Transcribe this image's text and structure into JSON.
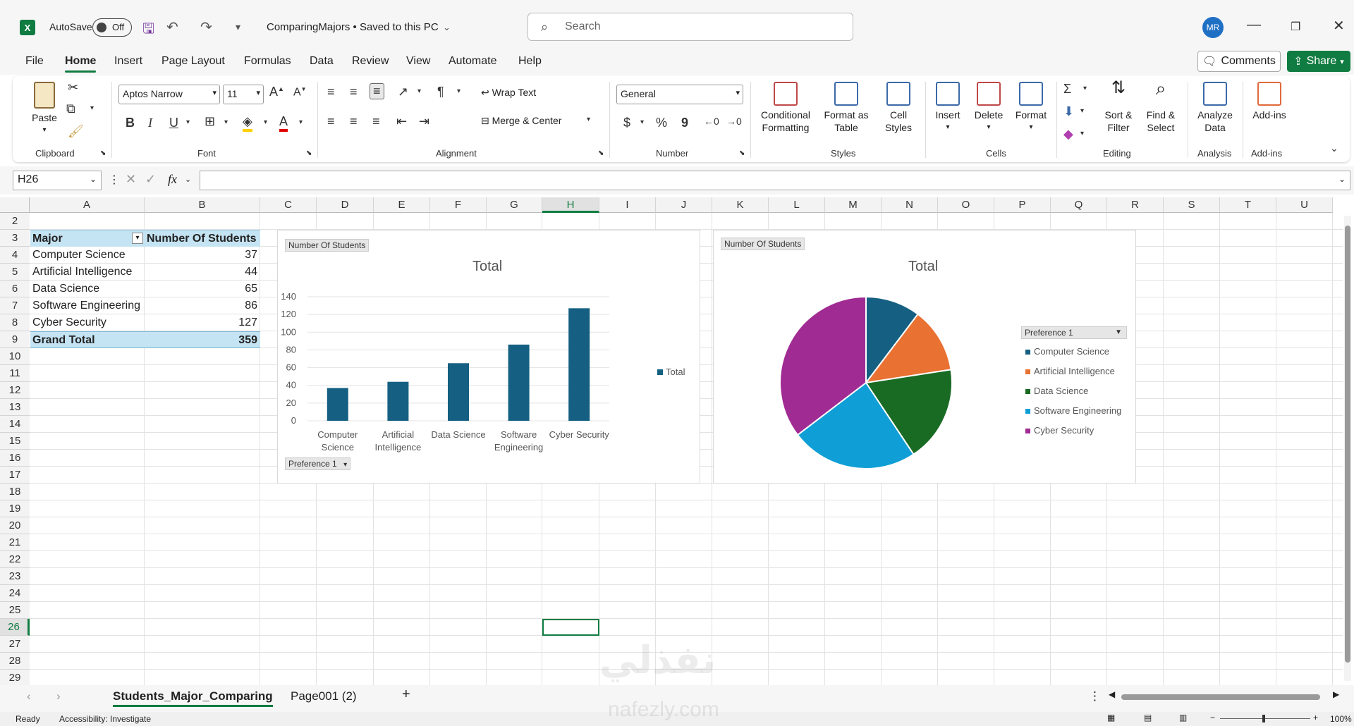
{
  "titlebar": {
    "app_logo": "X",
    "autosave_label": "AutoSave",
    "autosave_state": "Off",
    "doc_title": "ComparingMajors • Saved to this PC",
    "search_placeholder": "Search",
    "avatar_initials": "MR"
  },
  "menu": {
    "items": [
      "File",
      "Home",
      "Insert",
      "Page Layout",
      "Formulas",
      "Data",
      "Review",
      "View",
      "Automate",
      "Help"
    ],
    "active": "Home",
    "comments_label": "Comments",
    "share_label": "Share"
  },
  "ribbon": {
    "clipboard": {
      "paste": "Paste",
      "label": "Clipboard"
    },
    "font": {
      "name": "Aptos Narrow",
      "size": "11",
      "bold": "B",
      "italic": "I",
      "underline": "U",
      "label": "Font"
    },
    "alignment": {
      "wrap": "Wrap Text",
      "merge": "Merge & Center",
      "label": "Alignment"
    },
    "number": {
      "format": "General",
      "currency": "$",
      "percent": "%",
      "comma": "9",
      "label": "Number"
    },
    "styles": {
      "conditional": "Conditional",
      "conditional2": "Formatting",
      "format_table": "Format as",
      "format_table2": "Table",
      "cell_styles": "Cell",
      "cell_styles2": "Styles",
      "label": "Styles"
    },
    "cells": {
      "insert": "Insert",
      "delete": "Delete",
      "format": "Format",
      "label": "Cells"
    },
    "editing": {
      "sort": "Sort &",
      "sort2": "Filter",
      "find": "Find &",
      "find2": "Select",
      "label": "Editing"
    },
    "analysis": {
      "analyze": "Analyze",
      "analyze2": "Data",
      "label": "Analysis"
    },
    "addins": {
      "addins": "Add-ins",
      "label": "Add-ins"
    }
  },
  "formula_bar": {
    "cell_ref": "H26",
    "fx": "fx",
    "content": ""
  },
  "grid": {
    "columns": [
      "A",
      "B",
      "C",
      "D",
      "E",
      "F",
      "G",
      "H",
      "I",
      "J",
      "K",
      "L",
      "M",
      "N",
      "O",
      "P",
      "Q",
      "R",
      "S",
      "T",
      "U"
    ],
    "rows": [
      "2",
      "3",
      "4",
      "5",
      "6",
      "7",
      "8",
      "9",
      "10",
      "11",
      "12",
      "13",
      "14",
      "15",
      "16",
      "17",
      "18",
      "19",
      "20",
      "21",
      "22",
      "23",
      "24",
      "25",
      "26",
      "27",
      "28",
      "29"
    ],
    "selected_col": "H",
    "selected_row": "26"
  },
  "pivot": {
    "header_major": "Major",
    "header_count": "Number Of Students",
    "rows": [
      {
        "major": "Computer Science",
        "count": "37"
      },
      {
        "major": "Artificial Intelligence",
        "count": "44"
      },
      {
        "major": "Data Science",
        "count": "65"
      },
      {
        "major": "Software Engineering",
        "count": "86"
      },
      {
        "major": "Cyber Security",
        "count": "127"
      }
    ],
    "total_label": "Grand Total",
    "total_value": "359"
  },
  "chart_data": [
    {
      "type": "bar",
      "title": "Total",
      "field_button": "Number Of  Students",
      "axis_field_button": "Preference 1",
      "categories": [
        "Computer Science",
        "Artificial Intelligence",
        "Data Science",
        "Software Engineering",
        "Cyber Security"
      ],
      "category_lines": [
        [
          "Computer",
          "Science"
        ],
        [
          "Artificial",
          "Intelligence"
        ],
        [
          "Data Science"
        ],
        [
          "Software",
          "Engineering"
        ],
        [
          "Cyber Security"
        ]
      ],
      "series": [
        {
          "name": "Total",
          "values": [
            37,
            44,
            65,
            86,
            127
          ],
          "color": "#156082"
        }
      ],
      "yticks": [
        "0",
        "20",
        "40",
        "60",
        "80",
        "100",
        "120",
        "140"
      ],
      "ylim": [
        0,
        140
      ],
      "legend": "right"
    },
    {
      "type": "pie",
      "title": "Total",
      "field_button": "Number Of  Students",
      "legend_field_button": "Preference 1",
      "categories": [
        "Computer Science",
        "Artificial Intelligence",
        "Data Science",
        "Software Engineering",
        "Cyber Security"
      ],
      "values": [
        37,
        44,
        65,
        86,
        127
      ],
      "colors": [
        "#156082",
        "#e97132",
        "#196b24",
        "#0f9ed5",
        "#a02b93"
      ],
      "legend": "right"
    }
  ],
  "sheets": {
    "tabs": [
      "Students_Major_Comparing",
      "Page001 (2)"
    ],
    "active": "Students_Major_Comparing",
    "add": "+"
  },
  "status": {
    "ready": "Ready",
    "accessibility": "Accessibility: Investigate",
    "zoom": "100%"
  },
  "watermark": {
    "arabic": "نفذلي",
    "latin": "nafezly.com"
  }
}
